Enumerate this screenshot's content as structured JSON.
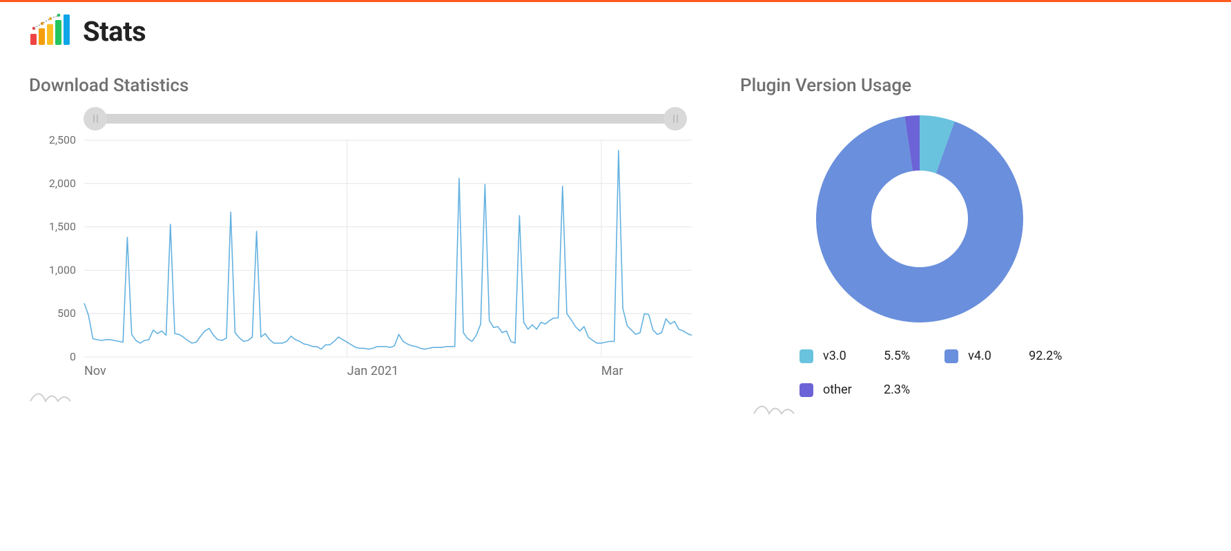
{
  "page_title": "Stats",
  "sections": {
    "downloads": {
      "title": "Download Statistics"
    },
    "versions": {
      "title": "Plugin Version Usage"
    }
  },
  "colors": {
    "accent": "#ff5a1f",
    "line": "#64b1e0",
    "grid": "#e6e6e6",
    "axis_text": "#6f6f70",
    "donut_v3": "#6ac3de",
    "donut_v4": "#6a8fdc",
    "donut_other": "#6b63d6"
  },
  "chart_data": [
    {
      "id": "downloads-line",
      "type": "line",
      "title": "Download Statistics",
      "xlabel": "",
      "ylabel": "",
      "ylim": [
        0,
        2500
      ],
      "y_ticks": [
        0,
        500,
        1000,
        1500,
        2000,
        2500
      ],
      "y_tick_labels": [
        "0",
        "500",
        "1,000",
        "1,500",
        "2,000",
        "2,500"
      ],
      "x_tick_indices": [
        0,
        61,
        120
      ],
      "x_tick_labels": [
        "Nov",
        "Jan 2021",
        "Mar"
      ],
      "x_gridline_indices": [
        61,
        120
      ],
      "series": [
        {
          "name": "downloads",
          "values": [
            620,
            480,
            210,
            200,
            190,
            200,
            200,
            190,
            180,
            170,
            1380,
            260,
            190,
            160,
            190,
            200,
            310,
            270,
            300,
            250,
            1530,
            270,
            260,
            230,
            190,
            160,
            170,
            240,
            300,
            330,
            250,
            200,
            190,
            220,
            1670,
            280,
            220,
            180,
            190,
            230,
            1450,
            230,
            270,
            200,
            160,
            160,
            160,
            180,
            240,
            200,
            180,
            150,
            140,
            120,
            120,
            90,
            140,
            140,
            180,
            230,
            200,
            170,
            140,
            110,
            100,
            100,
            90,
            100,
            120,
            120,
            120,
            110,
            130,
            260,
            180,
            150,
            130,
            120,
            100,
            90,
            100,
            110,
            110,
            110,
            120,
            120,
            120,
            2060,
            280,
            210,
            180,
            250,
            380,
            1990,
            420,
            340,
            350,
            280,
            300,
            180,
            160,
            1630,
            400,
            320,
            370,
            320,
            400,
            380,
            420,
            450,
            450,
            1970,
            500,
            430,
            350,
            300,
            350,
            230,
            190,
            160,
            160,
            170,
            180,
            180,
            2380,
            560,
            360,
            310,
            260,
            280,
            500,
            490,
            310,
            260,
            280,
            440,
            380,
            410,
            320,
            300,
            270,
            250
          ]
        }
      ]
    },
    {
      "id": "versions-donut",
      "type": "pie",
      "title": "Plugin Version Usage",
      "series": [
        {
          "name": "v3.0",
          "value": 5.5,
          "pct": "5.5%",
          "color": "#6ac3de"
        },
        {
          "name": "v4.0",
          "value": 92.2,
          "pct": "92.2%",
          "color": "#6a8fdc"
        },
        {
          "name": "other",
          "value": 2.3,
          "pct": "2.3%",
          "color": "#6b63d6"
        }
      ]
    }
  ]
}
